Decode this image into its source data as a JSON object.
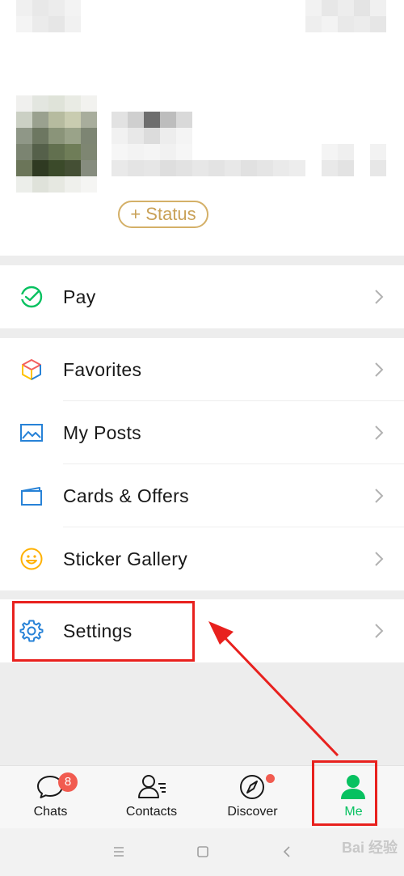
{
  "profile": {
    "status_label": "+ Status"
  },
  "pay_section": {
    "items": [
      {
        "label": "Pay",
        "icon": "pay-icon"
      }
    ]
  },
  "features_section": {
    "items": [
      {
        "label": "Favorites",
        "icon": "favorites-icon"
      },
      {
        "label": "My Posts",
        "icon": "my-posts-icon"
      },
      {
        "label": "Cards & Offers",
        "icon": "cards-icon"
      },
      {
        "label": "Sticker Gallery",
        "icon": "sticker-icon"
      }
    ]
  },
  "settings_section": {
    "items": [
      {
        "label": "Settings",
        "icon": "gear-icon"
      }
    ]
  },
  "tabbar": {
    "tabs": [
      {
        "label": "Chats",
        "badge": "8"
      },
      {
        "label": "Contacts"
      },
      {
        "label": "Discover"
      },
      {
        "label": "Me",
        "active": true
      }
    ]
  },
  "watermark": "Bai 经验",
  "colors": {
    "accent_green": "#07c160",
    "status_gold": "#c9a157",
    "badge_red": "#f15b50",
    "annotation_red": "#e8211e"
  }
}
